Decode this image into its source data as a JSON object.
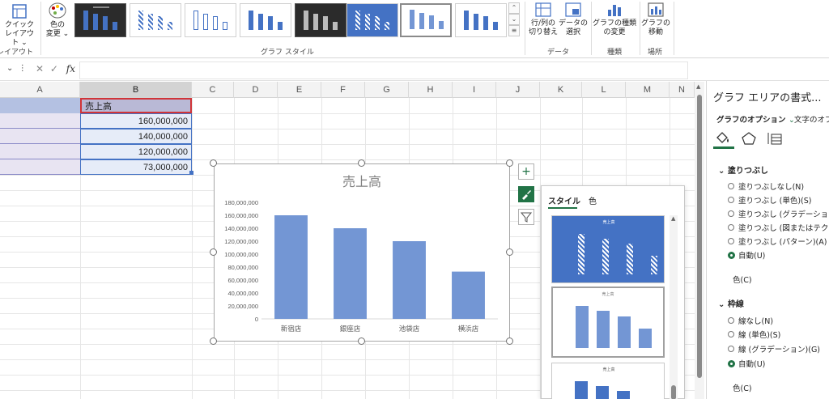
{
  "ribbon": {
    "quick_layout_label_1": "クイック",
    "quick_layout_label_2": "レイアウト",
    "change_color_label_1": "色の",
    "change_color_label_2": "変更",
    "layout_group_label": "レイアウト",
    "chart_styles_group_label": "グラフ スタイル",
    "switch_row_col_label_1": "行/列の",
    "switch_row_col_label_2": "切り替え",
    "select_data_label_1": "データの",
    "select_data_label_2": "選択",
    "data_group_label": "データ",
    "change_type_label_1": "グラフの種類",
    "change_type_label_2": "の変更",
    "type_group_label": "種類",
    "move_chart_label_1": "グラフの",
    "move_chart_label_2": "移動",
    "location_group_label": "場所"
  },
  "formula_bar": {
    "fx_label": "fx",
    "value": ""
  },
  "columns": [
    "A",
    "B",
    "C",
    "D",
    "E",
    "F",
    "G",
    "H",
    "I",
    "J",
    "K",
    "L",
    "M",
    "N"
  ],
  "sheet": {
    "header": "売上高",
    "values": [
      "160,000,000",
      "140,000,000",
      "120,000,000",
      "73,000,000"
    ]
  },
  "chart_data": {
    "type": "bar",
    "title": "売上高",
    "categories": [
      "新宿店",
      "銀座店",
      "池袋店",
      "横浜店"
    ],
    "values": [
      160000000,
      140000000,
      120000000,
      73000000
    ],
    "ylim": [
      0,
      180000000
    ],
    "yticks": [
      "0",
      "20,000,000",
      "40,000,000",
      "60,000,000",
      "80,000,000",
      "100,000,000",
      "120,000,000",
      "140,000,000",
      "160,000,000",
      "180,000,000"
    ],
    "bar_color": "#7396d4",
    "legend": "none",
    "grid": false
  },
  "style_popup": {
    "tab_style": "スタイル",
    "tab_color": "色",
    "preview_title": "売上高"
  },
  "format_pane": {
    "title": "グラフ エリアの書式...",
    "graph_options": "グラフのオプション",
    "text_options": "文字のオプシ",
    "fill_section": "塗りつぶし",
    "fill_options": [
      "塗りつぶしなし(N)",
      "塗りつぶし (単色)(S)",
      "塗りつぶし (グラデーション)(G)",
      "塗りつぶし (図またはテクスチャ)(",
      "塗りつぶし (パターン)(A)",
      "自動(U)"
    ],
    "fill_color_label": "色(C)",
    "line_section": "枠線",
    "line_options": [
      "線なし(N)",
      "線 (単色)(S)",
      "線 (グラデーション)(G)",
      "自動(U)"
    ],
    "line_color_label": "色(C)"
  },
  "colors": {
    "accent_green": "#217346",
    "bar_blue": "#7396d4",
    "style_blue": "#4472c4"
  }
}
